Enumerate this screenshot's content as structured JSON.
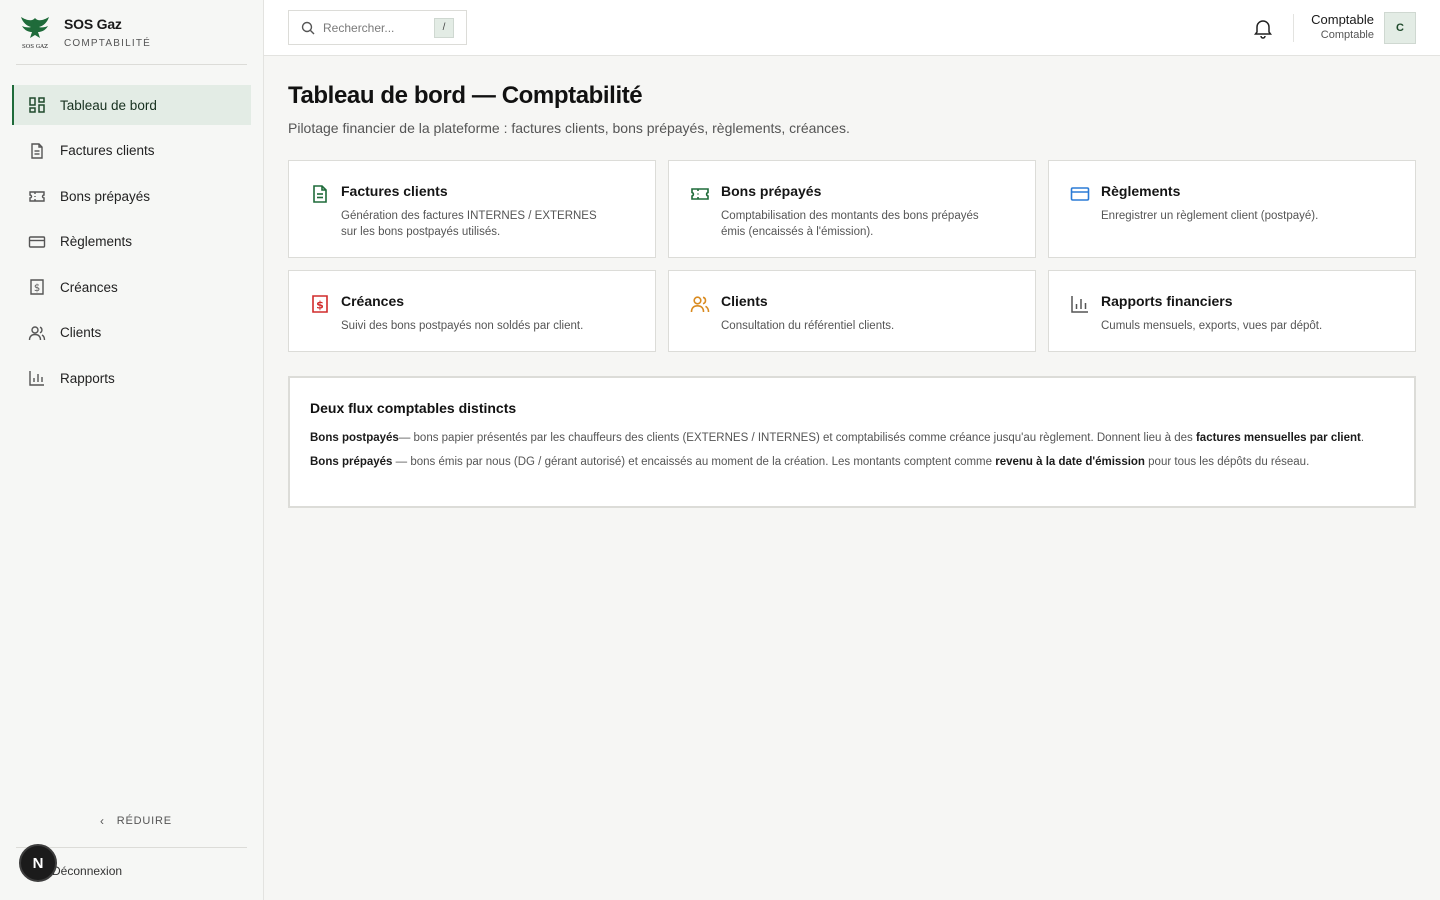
{
  "brand": {
    "name": "SOS Gaz",
    "subtitle": "COMPTABILITÉ",
    "logo_text": "SOS GAZ"
  },
  "sidebar": {
    "items": [
      {
        "label": "Tableau de bord",
        "icon": "dashboard-icon",
        "active": true
      },
      {
        "label": "Factures clients",
        "icon": "document-icon"
      },
      {
        "label": "Bons prépayés",
        "icon": "ticket-icon"
      },
      {
        "label": "Règlements",
        "icon": "credit-card-icon"
      },
      {
        "label": "Créances",
        "icon": "dollar-receipt-icon"
      },
      {
        "label": "Clients",
        "icon": "users-icon"
      },
      {
        "label": "Rapports",
        "icon": "bar-chart-icon"
      }
    ],
    "collapse_label": "RÉDUIRE",
    "logout_label": "Déconnexion",
    "badge_letter": "N"
  },
  "topbar": {
    "search_placeholder": "Rechercher...",
    "search_shortcut": "/",
    "user_name": "Comptable",
    "user_role": "Comptable",
    "avatar_letter": "C"
  },
  "page": {
    "title": "Tableau de bord — Comptabilité",
    "subtitle": "Pilotage financier de la plateforme : factures clients, bons prépayés, règlements, créances."
  },
  "cards": [
    {
      "title": "Factures clients",
      "description": "Génération des factures INTERNES / EXTERNES sur les bons postpayés utilisés.",
      "icon": "document-icon",
      "color": "#1f6b3a"
    },
    {
      "title": "Bons prépayés",
      "description": "Comptabilisation des montants des bons prépayés émis (encaissés à l'émission).",
      "icon": "ticket-icon",
      "color": "#1f6b3a"
    },
    {
      "title": "Règlements",
      "description": "Enregistrer un règlement client (postpayé).",
      "icon": "credit-card-icon",
      "color": "#2b7bd6"
    },
    {
      "title": "Créances",
      "description": "Suivi des bons postpayés non soldés par client.",
      "icon": "dollar-receipt-icon",
      "color": "#d12b2b"
    },
    {
      "title": "Clients",
      "description": "Consultation du référentiel clients.",
      "icon": "users-icon",
      "color": "#d98a1f"
    },
    {
      "title": "Rapports financiers",
      "description": "Cumuls mensuels, exports, vues par dépôt.",
      "icon": "bar-chart-icon",
      "color": "#555555"
    }
  ],
  "info": {
    "title": "Deux flux comptables distincts",
    "p1_bold": "Bons postpayés",
    "p1_text": "— bons papier présentés par les chauffeurs des clients (EXTERNES / INTERNES) et comptabilisés comme créance jusqu'au règlement. Donnent lieu à des ",
    "p1_bold2": "factures mensuelles par client",
    "p1_end": ".",
    "p2_bold": "Bons prépayés",
    "p2_text": " — bons émis par nous (DG / gérant autorisé) et encaissés au moment de la création. Les montants comptent comme ",
    "p2_bold2": "revenu à la date d'émission",
    "p2_end": " pour tous les dépôts du réseau."
  },
  "colors": {
    "accent": "#1f6b3a",
    "active_bg": "#e3ece5"
  }
}
